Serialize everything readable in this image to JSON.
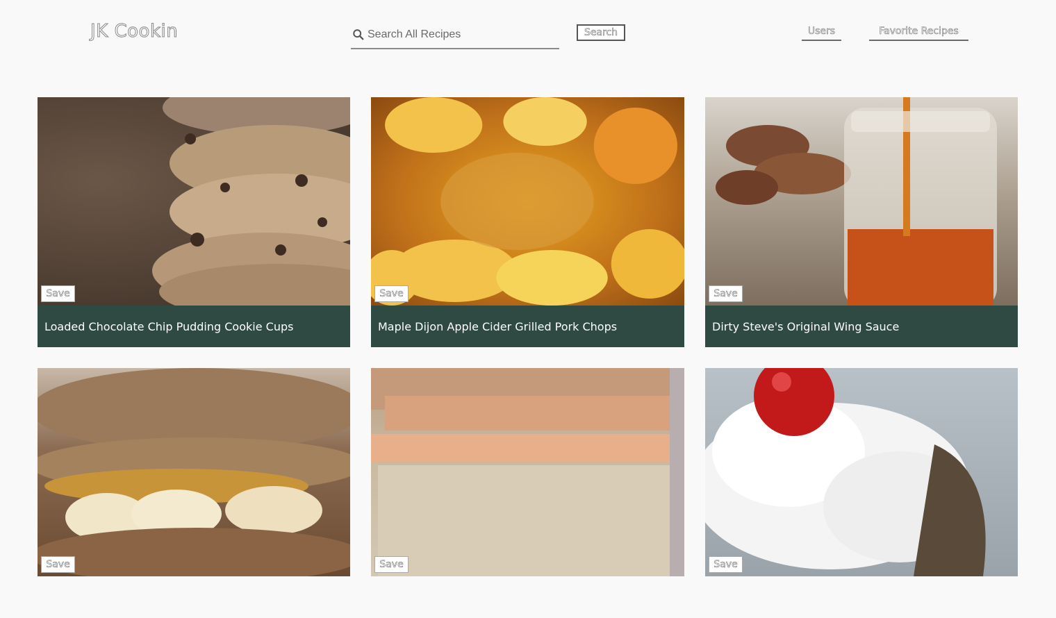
{
  "header": {
    "logo": "JK Cookin",
    "search_placeholder": "Search All Recipes",
    "search_button": "Search",
    "nav": {
      "users": "Users",
      "favorites": "Favorite Recipes"
    }
  },
  "save_label": "Save",
  "recipes": [
    {
      "title": "Loaded Chocolate Chip Pudding Cookie Cups",
      "image": "cookie-stack"
    },
    {
      "title": "Maple Dijon Apple Cider Grilled Pork Chops",
      "image": "glazed-pork-apples"
    },
    {
      "title": "Dirty Steve's Original Wing Sauce",
      "image": "sauce-jar"
    },
    {
      "title": "",
      "image": "banana-pancakes"
    },
    {
      "title": "",
      "image": "bread-loaf"
    },
    {
      "title": "",
      "image": "coconut-cupcake"
    }
  ]
}
